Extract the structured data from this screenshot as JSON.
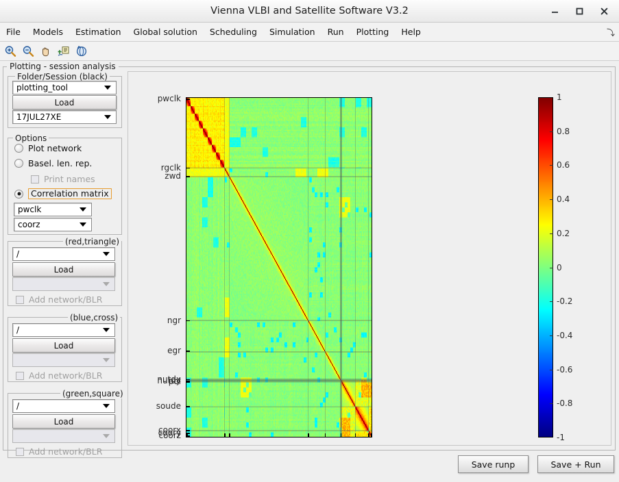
{
  "window": {
    "title": "Vienna VLBI and Satellite Software V3.2",
    "minimize_label": "–",
    "maximize_label": "□",
    "close_label": "✕"
  },
  "menubar": {
    "items": [
      {
        "label": "File"
      },
      {
        "label": "Models"
      },
      {
        "label": "Estimation"
      },
      {
        "label": "Global solution"
      },
      {
        "label": "Scheduling"
      },
      {
        "label": "Simulation"
      },
      {
        "label": "Run"
      },
      {
        "label": "Plotting"
      },
      {
        "label": "Help"
      }
    ],
    "overflow_label": "⤵"
  },
  "toolbar": {
    "buttons": [
      {
        "name": "zoom-in-icon",
        "tooltip": "Zoom In"
      },
      {
        "name": "zoom-out-icon",
        "tooltip": "Zoom Out"
      },
      {
        "name": "pan-hand-icon",
        "tooltip": "Pan"
      },
      {
        "name": "insert-legend-icon",
        "tooltip": "Insert Legend"
      },
      {
        "name": "rotate-3d-icon",
        "tooltip": "Rotate 3D"
      }
    ]
  },
  "panel": {
    "title": "Plotting - session analysis"
  },
  "folder_session": {
    "legend": "Folder/Session (black)",
    "folder_value": "plotting_tool",
    "load_label": "Load",
    "session_value": "17JUL27XE"
  },
  "options": {
    "legend": "Options",
    "plot_network": {
      "label": "Plot network",
      "checked": false
    },
    "baseline_len_rep": {
      "label": "Basel. len. rep.",
      "checked": false
    },
    "print_names": {
      "label": "Print names",
      "checked": false,
      "enabled": false
    },
    "correlation_matrix": {
      "label": "Correlation matrix",
      "checked": true,
      "focused": true
    },
    "param1_value": "pwclk",
    "param2_value": "coorz"
  },
  "red_triangle": {
    "legend": "(red,triangle)",
    "path_value": "/",
    "load_label": "Load",
    "session_value": "",
    "add_network_label": "Add network/BLR",
    "add_network_checked": false
  },
  "blue_cross": {
    "legend": "(blue,cross)",
    "path_value": "/",
    "load_label": "Load",
    "session_value": "",
    "add_network_label": "Add network/BLR",
    "add_network_checked": false
  },
  "green_square": {
    "legend": "(green,square)",
    "path_value": "/",
    "load_label": "Load",
    "session_value": "",
    "add_network_label": "Add network/BLR",
    "add_network_checked": false
  },
  "footer": {
    "save_runp_label": "Save runp",
    "save_run_label": "Save + Run"
  },
  "chart_data": {
    "type": "heatmap",
    "title": "",
    "xlabel": "",
    "ylabel": "",
    "colormap": "jet",
    "colorbar": {
      "min": -1,
      "max": 1,
      "ticks": [
        1,
        0.8,
        0.6,
        0.4,
        0.2,
        0,
        -0.2,
        -0.4,
        -0.6,
        -0.8,
        -1
      ],
      "tick_labels": [
        "1",
        "0.8",
        "0.6",
        "0.4",
        "0.2",
        "0",
        "-0.2",
        "-0.4",
        "-0.6",
        "-0.8",
        "-1"
      ]
    },
    "matrix_size": 272,
    "y_tick_labels": [
      {
        "label": "pwclk",
        "pos": 0.005
      },
      {
        "label": "rgclk",
        "pos": 0.207
      },
      {
        "label": "zwd",
        "pos": 0.232
      },
      {
        "label": "ngr",
        "pos": 0.655
      },
      {
        "label": "egr",
        "pos": 0.745
      },
      {
        "label": "nutdx",
        "pos": 0.828
      },
      {
        "label": "nutdy",
        "pos": 0.832
      },
      {
        "label": "pol",
        "pos": 0.836
      },
      {
        "label": "soude",
        "pos": 0.908
      },
      {
        "label": "coorx",
        "pos": 0.978
      },
      {
        "label": "coory",
        "pos": 0.986
      },
      {
        "label": "coorz",
        "pos": 0.994
      }
    ],
    "x_tick_positions": [
      0.005,
      0.207,
      0.232,
      0.655,
      0.745,
      0.83,
      0.908,
      0.978,
      0.994
    ],
    "block_boundaries": [
      0.0,
      0.207,
      0.232,
      0.655,
      0.745,
      0.83,
      0.908,
      0.978,
      1.0
    ],
    "description": "Parameter correlation matrix, symmetric, unit diagonal. Upper-left pwclk region shows 9 strong red on-diagonal sub-blocks with yellow off-diagonal correlations; remaining bulk is near-zero (green) with yellow/orange structure in lower-right coor/soude blocks and scattered cyan negative correlations.",
    "blocks": [
      {
        "name": "pwclk",
        "start": 0.0,
        "end": 0.207,
        "sub_blocks": 9,
        "diag_value": 1.0,
        "off_diag_value": 0.25
      },
      {
        "name": "rgclk",
        "start": 0.207,
        "end": 0.232,
        "diag_value": 1.0,
        "off_diag_value": 0.2
      },
      {
        "name": "zwd",
        "start": 0.232,
        "end": 0.655,
        "diag_value": 1.0,
        "off_diag_value": 0.05
      },
      {
        "name": "ngr",
        "start": 0.655,
        "end": 0.745,
        "diag_value": 1.0,
        "off_diag_value": 0.03
      },
      {
        "name": "egr",
        "start": 0.745,
        "end": 0.83,
        "diag_value": 1.0,
        "off_diag_value": 0.03
      },
      {
        "name": "nutdx/nutdy/pol",
        "start": 0.83,
        "end": 0.908,
        "diag_value": 1.0,
        "off_diag_value": 0.15
      },
      {
        "name": "soude",
        "start": 0.908,
        "end": 0.978,
        "diag_value": 1.0,
        "off_diag_value": 0.35
      },
      {
        "name": "coorx/coory/coorz",
        "start": 0.978,
        "end": 1.0,
        "diag_value": 1.0,
        "off_diag_value": 0.3
      }
    ]
  }
}
